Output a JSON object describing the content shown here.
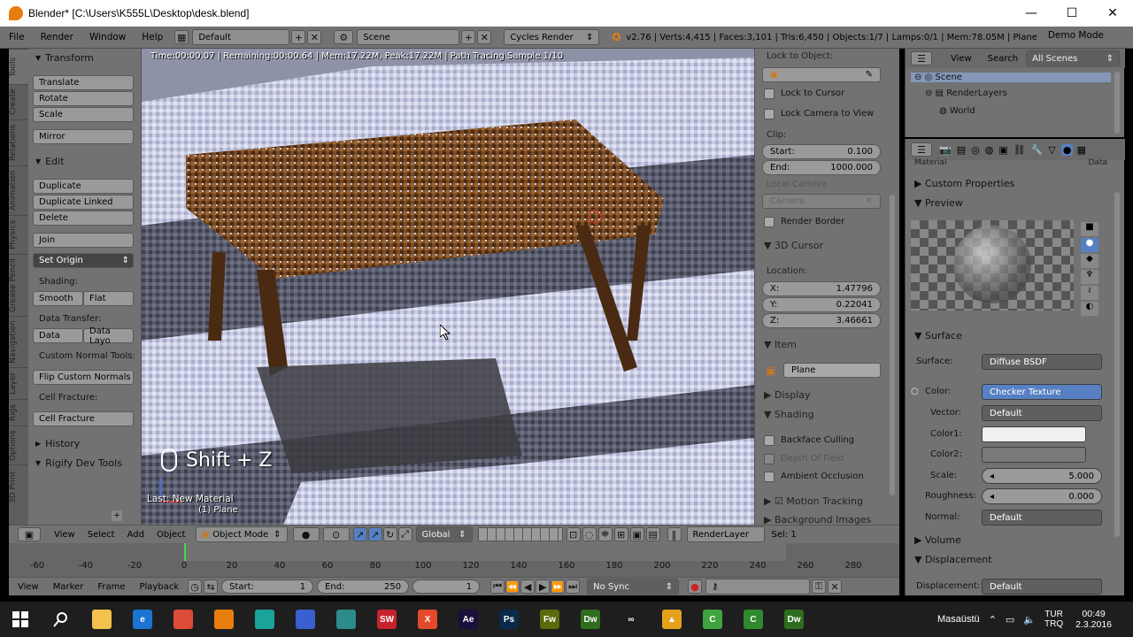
{
  "window": {
    "title": "Blender* [C:\\Users\\K555L\\Desktop\\desk.blend]",
    "minimize": "—",
    "maximize": "☐",
    "close": "✕"
  },
  "info_header": {
    "menus": [
      "File",
      "Render",
      "Window",
      "Help"
    ],
    "screen_layout": "Default",
    "scene": "Scene",
    "render_engine": "Cycles Render",
    "stats": "v2.76 | Verts:4,415 | Faces:3,101 | Tris:6,450 | Objects:1/7 | Lamps:0/1 | Mem:78.05M | Plane",
    "mode": "Demo Mode"
  },
  "tab_strip": [
    "Tools",
    "Create",
    "Relations",
    "Animation",
    "Physics",
    "Grease Pencil",
    "Navigation",
    "Layer",
    "Rigs",
    "Options",
    "3D Print"
  ],
  "tool_shelf": {
    "transform_header": "Transform",
    "translate": "Translate",
    "rotate": "Rotate",
    "scale": "Scale",
    "mirror": "Mirror",
    "edit_header": "Edit",
    "duplicate": "Duplicate",
    "duplicate_linked": "Duplicate Linked",
    "delete": "Delete",
    "join": "Join",
    "set_origin": "Set Origin",
    "shading_label": "Shading:",
    "smooth": "Smooth",
    "flat": "Flat",
    "data_transfer_label": "Data Transfer:",
    "data": "Data",
    "data_layo": "Data Layo",
    "custom_normal_label": "Custom Normal Tools:",
    "flip_normals": "Flip Custom Normals",
    "cell_fracture_label": "Cell Fracture:",
    "cell_fracture": "Cell Fracture",
    "history_header": "History",
    "rigify_header": "Rigify Dev Tools"
  },
  "viewport": {
    "render_info": "Time:00:00.07 | Remaining:00:00.64 | Mem:17.22M, Peak:17.22M | Path Tracing Sample 1/10",
    "keycast": "Shift + Z",
    "last_op": "Last: New Material",
    "object_name": "(1) Plane"
  },
  "n_panel": {
    "lock_to_object": "Lock to Object:",
    "lock_to_cursor": "Lock to Cursor",
    "lock_camera": "Lock Camera to View",
    "clip": "Clip:",
    "start_label": "Start:",
    "start_val": "0.100",
    "end_label": "End:",
    "end_val": "1000.000",
    "local_camera": "Local Camera",
    "camera": "Camera",
    "render_border": "Render Border",
    "cursor_header": "3D Cursor",
    "location": "Location:",
    "x_label": "X:",
    "x_val": "1.47796",
    "y_label": "Y:",
    "y_val": "0.22041",
    "z_label": "Z:",
    "z_val": "3.46661",
    "item_header": "Item",
    "item_name": "Plane",
    "display_header": "Display",
    "shading_header": "Shading",
    "backface": "Backface Culling",
    "dof": "Depth Of Field",
    "ao": "Ambient Occlusion",
    "motion_tracking": "Motion Tracking",
    "background_images": "Background Images"
  },
  "outliner": {
    "view": "View",
    "search": "Search",
    "filter": "All Scenes",
    "items": [
      "Scene",
      "RenderLayers",
      "World"
    ]
  },
  "properties": {
    "material_field": "Material",
    "data_field": "Data",
    "custom_props": "Custom Properties",
    "preview": "Preview",
    "surface_header": "Surface",
    "surface_label": "Surface:",
    "surface_val": "Diffuse BSDF",
    "color_label": "Color:",
    "color_val": "Checker Texture",
    "vector_label": "Vector:",
    "vector_val": "Default",
    "color1_label": "Color1:",
    "color2_label": "Color2:",
    "scale_label": "Scale:",
    "scale_val": "5.000",
    "roughness_label": "Roughness:",
    "roughness_val": "0.000",
    "normal_label": "Normal:",
    "normal_val": "Default",
    "volume_header": "Volume",
    "displacement_header": "Displacement",
    "displacement_label": "Displacement:",
    "displacement_val": "Default"
  },
  "view_header": {
    "menus": [
      "View",
      "Select",
      "Add",
      "Object"
    ],
    "mode": "Object Mode",
    "orientation": "Global",
    "render_layer": "RenderLayer",
    "sel": "Sel: 1"
  },
  "timeline": {
    "ticks": [
      "-60",
      "-40",
      "-20",
      "0",
      "20",
      "40",
      "60",
      "80",
      "100",
      "120",
      "140",
      "160",
      "180",
      "200",
      "220",
      "240",
      "260",
      "280"
    ],
    "menus": [
      "View",
      "Marker",
      "Frame",
      "Playback"
    ],
    "start_label": "Start:",
    "start_val": "1",
    "end_label": "End:",
    "end_val": "250",
    "current_val": "1",
    "sync": "No Sync"
  },
  "taskbar": {
    "apps": [
      {
        "name": "windows-start-icon",
        "label": "",
        "color": "#1e1e1e"
      },
      {
        "name": "search-icon",
        "label": "",
        "color": "#1e1e1e"
      },
      {
        "name": "file-explorer-icon",
        "label": "",
        "color": "#f2c14e"
      },
      {
        "name": "edge-icon",
        "label": "e",
        "color": "#1b74d1"
      },
      {
        "name": "chrome-icon",
        "label": "",
        "color": "#dd4b39"
      },
      {
        "name": "blender-icon",
        "label": "",
        "color": "#e87d0d"
      },
      {
        "name": "app-teal-icon",
        "label": "",
        "color": "#1aa39a"
      },
      {
        "name": "app-orb-icon",
        "label": "",
        "color": "#3a5fd0"
      },
      {
        "name": "app-globe-icon",
        "label": "",
        "color": "#2e8b8b"
      },
      {
        "name": "app-sw-icon",
        "label": "SW",
        "color": "#c8232c"
      },
      {
        "name": "app-x-icon",
        "label": "X",
        "color": "#e3492b"
      },
      {
        "name": "after-effects-icon",
        "label": "Ae",
        "color": "#1b0f3d"
      },
      {
        "name": "photoshop-icon",
        "label": "Ps",
        "color": "#0b2a4a"
      },
      {
        "name": "fireworks-icon",
        "label": "Fw",
        "color": "#5a6b0c"
      },
      {
        "name": "dreamweaver-icon",
        "label": "Dw",
        "color": "#2f6d1f"
      },
      {
        "name": "app-infinity-icon",
        "label": "∞",
        "color": "#1e1e1e"
      },
      {
        "name": "app-triangle-icon",
        "label": "▲",
        "color": "#e4a11b"
      },
      {
        "name": "app-c-icon",
        "label": "C",
        "color": "#3fa33f"
      },
      {
        "name": "app-c2-icon",
        "label": "C",
        "color": "#2f8a2f"
      },
      {
        "name": "dreamweaver2-icon",
        "label": "Dw",
        "color": "#2f6d1f"
      }
    ],
    "desktop_label": "Masaüstü",
    "lang": "TUR",
    "lang2": "TRQ",
    "time": "00:49",
    "date": "2.3.2016"
  }
}
